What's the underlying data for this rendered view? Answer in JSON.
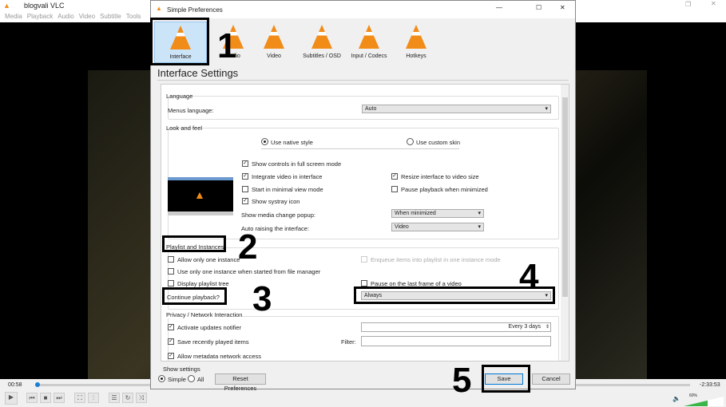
{
  "vlc": {
    "title": "blogvali VLC",
    "menu": [
      "Media",
      "Playback",
      "Audio",
      "Video",
      "Subtitle",
      "Tools"
    ],
    "time_elapsed": "00:58",
    "time_remaining": "-2:33:53",
    "volume": "60%",
    "progress_fraction": 0.006,
    "volume_fraction": 0.6
  },
  "dialog": {
    "title": "Simple Preferences",
    "tabs": [
      {
        "label": "Interface",
        "selected": true
      },
      {
        "label": "Audio"
      },
      {
        "label": "Video"
      },
      {
        "label": "Subtitles / OSD"
      },
      {
        "label": "Input / Codecs"
      },
      {
        "label": "Hotkeys"
      }
    ],
    "heading": "Interface Settings",
    "language": {
      "title": "Language",
      "menus_label": "Menus language:",
      "menus_value": "Auto"
    },
    "look": {
      "title": "Look and feel",
      "native": "Use native style",
      "custom": "Use custom skin",
      "show_controls": "Show controls in full screen mode",
      "integrate": "Integrate video in interface",
      "resize": "Resize interface to video size",
      "minimal": "Start in minimal view mode",
      "pause_min": "Pause playback when minimized",
      "systray": "Show systray icon",
      "popup_label": "Show media change popup:",
      "popup_value": "When minimized",
      "raise_label": "Auto raising the interface:",
      "raise_value": "Video"
    },
    "playlist": {
      "title": "Playlist and Instances",
      "one_instance": "Allow only one instance",
      "enqueue": "Enqueue items into playlist in one instance mode",
      "file_manager": "Use only one instance when started from file manager",
      "tree": "Display playlist tree",
      "pause_last": "Pause on the last frame of a video",
      "continue_label": "Continue playback?",
      "continue_value": "Always"
    },
    "privacy": {
      "title": "Privacy / Network Interaction",
      "updates": "Activate updates notifier",
      "updates_value": "Every 3 days",
      "recent": "Save recently played items",
      "filter_label": "Filter:",
      "metadata": "Allow metadata network access"
    },
    "show_settings": {
      "title": "Show settings",
      "simple": "Simple",
      "all": "All"
    },
    "reset": "Reset Preferences",
    "save": "Save",
    "cancel": "Cancel"
  },
  "annotations": [
    "1",
    "2",
    "3",
    "4",
    "5"
  ]
}
